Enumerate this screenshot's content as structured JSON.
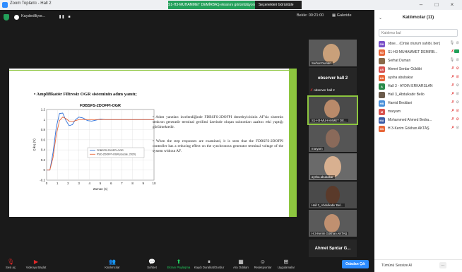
{
  "titlebar": {
    "title": "Zoom Toplantı - Hall 2",
    "share_banner": "S1-H3-MUHAMMET DEMİRBAŞ ekranını görüntülüyorsunuz",
    "view_options": "Seçenekleri Görüntüle",
    "minimize": "–",
    "maximize": "□",
    "close": "×"
  },
  "meeting_top": {
    "recording": "Kaydediliyor...",
    "pause": "❚❚",
    "stop": "■",
    "timer": "Bekle: 00:21:00",
    "gallery": "Galeride"
  },
  "slide": {
    "heading": "•   Amplifikatör Filtresiz OGR sisteminin adım yanıtı;",
    "bullet1": "•   Adım yanıtları incelendiğinde FDBSFS-2DOFPI denetleyicisinin AF'siz sistemin senkron generatör terminal gerilimi üzerinde oluşan salınımları azaltıcı etki yaptığı görülmektedir.",
    "bullet2": "•   When the step responses are examined, it is seen that the FDBSFS-2DOFPI controller has a reducing effect on the synchronous generator terminal voltage of the system without AF."
  },
  "chart_data": {
    "type": "line",
    "title": "FDBSFS-2DOFPI-OGR",
    "xlabel": "Zaman (s)",
    "ylabel": "Çıkış (V)",
    "xlim": [
      0,
      10
    ],
    "ylim": [
      -0.2,
      1.2
    ],
    "xticks": [
      "0",
      "1",
      "2",
      "3",
      "4",
      "5",
      "6",
      "7",
      "8",
      "9",
      "10"
    ],
    "yticks": [
      "-0.2",
      "0",
      "0.2",
      "0.4",
      "0.6",
      "0.8",
      "1",
      "1.2"
    ],
    "grid": true,
    "legend_position": "center-right",
    "series": [
      {
        "name": "FDBSFS-2DOFPI-OGR",
        "color": "#2e6fd8",
        "x": [
          0,
          0.3,
          0.6,
          0.9,
          1.2,
          1.5,
          1.8,
          2.1,
          2.4,
          2.7,
          3.0,
          3.4,
          3.8,
          4.2,
          4.6,
          5.0,
          5.5,
          6.0,
          7.0,
          8.0,
          9.0,
          10.0
        ],
        "y": [
          0,
          0,
          0.35,
          0.85,
          1.12,
          1.13,
          0.98,
          0.88,
          0.9,
          1.0,
          1.05,
          1.03,
          0.98,
          0.97,
          0.99,
          1.01,
          1.0,
          1.0,
          1.0,
          1.0,
          1.0,
          1.0
        ]
      },
      {
        "name": "PSO-2DOFPI-OGR (Gozde, 2020)",
        "color": "#e8673a",
        "x": [
          0,
          0.3,
          0.6,
          0.9,
          1.2,
          1.5,
          1.8,
          2.1,
          2.4,
          2.7,
          3.0,
          3.4,
          3.8,
          4.2,
          4.6,
          5.0,
          5.5,
          6.0,
          7.0,
          8.0,
          9.0,
          10.0
        ],
        "y": [
          0,
          0,
          0.25,
          0.7,
          0.98,
          1.05,
          1.02,
          0.97,
          0.96,
          0.98,
          1.0,
          1.0,
          1.0,
          1.0,
          1.0,
          1.0,
          1.0,
          1.0,
          1.0,
          1.0,
          1.0,
          1.0
        ]
      }
    ]
  },
  "strip": {
    "tiles": [
      {
        "name": "Serhat Duman"
      },
      {
        "big": "observer hall 2",
        "small": "observer hall 2"
      },
      {
        "name": "S1-H3-MUHAMMET DE..."
      },
      {
        "name": "maryam"
      },
      {
        "name": "aysha abubakar"
      },
      {
        "name": "Hall 3_Abdulkabir Bel..."
      },
      {
        "name": "H 3-Kerim Gökhan AKTAŞ"
      },
      {
        "big": "Ahmet Serdar G...",
        "small": "Ahmet Serdar Güldibi"
      }
    ],
    "more": "⌄"
  },
  "bottombar": {
    "mute": "Sesi aç",
    "video": "Videoyu Başlat",
    "participants": "Katılımcılar",
    "participants_count": "11",
    "chat": "Sohbet",
    "share": "Ekranı Paylaşma",
    "record": "Kaydı Duraklat/Durdur",
    "breakout": "Ara Odaları",
    "reactions": "Reaksiyonlar",
    "apps": "Uygulamalar",
    "leave": "Odadan Çık"
  },
  "panel": {
    "title": "Katılımcılar (11)",
    "collapse": "⌄",
    "search_placeholder": "Katılımcı bul",
    "participants": [
      {
        "initials": "OH",
        "color": "#7b52c9",
        "name": "obse... (Ortak oturum sahibi, ben)"
      },
      {
        "initials": "SD",
        "color": "#e8673a",
        "name": "S1-H3-MUHAMMET DEMİRB..."
      },
      {
        "initials": "",
        "color": "#8a6a4a",
        "name": "Serhat Duman"
      },
      {
        "initials": "AS",
        "color": "#d9534f",
        "name": "Ahmet Serdar Güldibi"
      },
      {
        "initials": "AA",
        "color": "#e8673a",
        "name": "aysha abubakar"
      },
      {
        "initials": "A",
        "color": "#2a8a4a",
        "name": "Hall 3 - AYDIN ERKARSLAN"
      },
      {
        "initials": "",
        "color": "#6b5b4b",
        "name": "Hall 3_Abdulkabir Bello"
      },
      {
        "initials": "HB",
        "color": "#4a90d9",
        "name": "Hamid Beddani"
      },
      {
        "initials": "M",
        "color": "#d9534f",
        "name": "maryam"
      },
      {
        "initials": "MA",
        "color": "#3b5ba5",
        "name": "Mohammed Ahmed Bedra..."
      },
      {
        "initials": "HK",
        "color": "#e8673a",
        "name": "H 3-Kerim Gökhan AKTAŞ"
      }
    ],
    "invite": "Tümünü Sessize Al",
    "more": "..."
  }
}
